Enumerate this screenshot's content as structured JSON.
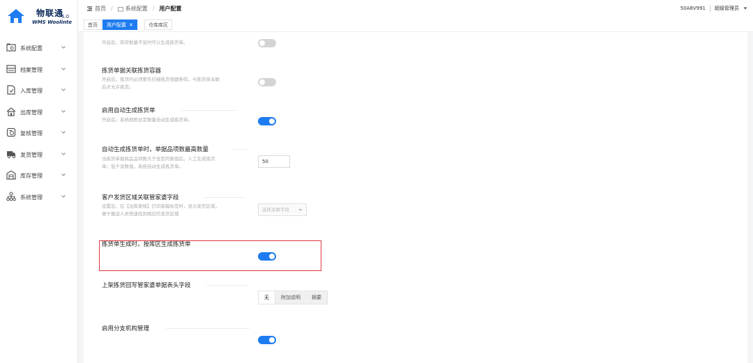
{
  "app": {
    "logo_name": "物联通",
    "logo_version": "5.0",
    "logo_sub": "WMS Woolinte"
  },
  "sidebar": {
    "items": [
      {
        "label": "系统配置",
        "icon": "settings-folder-icon"
      },
      {
        "label": "档案管理",
        "icon": "archive-icon"
      },
      {
        "label": "入库管理",
        "icon": "inbound-icon"
      },
      {
        "label": "出库管理",
        "icon": "outbound-icon"
      },
      {
        "label": "复核管理",
        "icon": "review-icon"
      },
      {
        "label": "发货管理",
        "icon": "truck-icon"
      },
      {
        "label": "库存管理",
        "icon": "inventory-icon"
      },
      {
        "label": "系统管理",
        "icon": "org-tree-icon"
      }
    ]
  },
  "header": {
    "breadcrumb": [
      "首页",
      "系统配置",
      "用户配置"
    ],
    "code": "50A8V991",
    "user": "超级管理员"
  },
  "tabs": [
    {
      "label": "首页",
      "active": false
    },
    {
      "label": "用户配置",
      "active": true,
      "close": "✕"
    },
    {
      "label": "仓库库区",
      "active": false
    }
  ],
  "settings": {
    "r0": {
      "desc": "开启后，库存数量不足时可以生成拣货单。",
      "state": "off"
    },
    "r1": {
      "title": "拣货单据关联拣货容器",
      "desc": "开启后，拣货时必须要先扫描拣货容器条码，与拣货单关联后才允许拣货。",
      "state": "off"
    },
    "r2": {
      "title": "启用自动生成拣货单",
      "desc": "开启后，系统按照设定数量自动生成拣货单。",
      "state": "on"
    },
    "r3": {
      "title": "自动生成拣货单时，单据品项数最高数量",
      "desc": "当拣货单据商品品项数大于设定的数值后，人工生成拣货单；低于该数值，系统自动生成拣货单。",
      "value": "50"
    },
    "r4": {
      "title": "客户发货区域关联管家婆字段",
      "desc": "设置后，在【出库复核】打印装箱标签时，显示发货区域，便于搬运人员快速找到相应的发货区域",
      "placeholder": "选择关联字段"
    },
    "r5": {
      "title": "拣货单生成时，按库区生成拣货单",
      "state": "on"
    },
    "r6": {
      "title": "上架拣货回写管家婆单据表头字段",
      "options": [
        "无",
        "附加说明",
        "摘要"
      ],
      "selected": "无"
    },
    "r7": {
      "title": "启用分支机构管理",
      "state": "on"
    }
  },
  "colors": {
    "accent": "#1e7cf0",
    "highlight": "#e0373f"
  }
}
